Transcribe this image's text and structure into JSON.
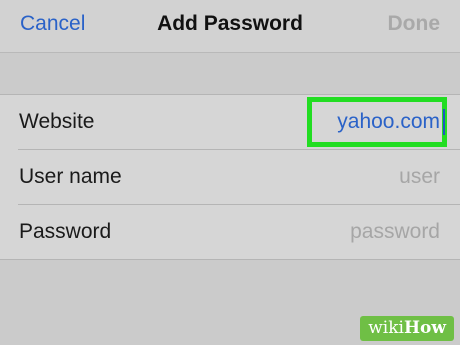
{
  "navbar": {
    "cancel_label": "Cancel",
    "title": "Add Password",
    "done_label": "Done"
  },
  "form": {
    "website": {
      "label": "Website",
      "value": "yahoo.com"
    },
    "username": {
      "label": "User name",
      "placeholder": "user"
    },
    "password": {
      "label": "Password",
      "placeholder": "password"
    }
  },
  "colors": {
    "accent": "#2a62c8",
    "highlight": "#22dd22",
    "placeholder": "#a6a6a6"
  },
  "watermark": {
    "prefix": "wiki",
    "suffix": "How"
  }
}
